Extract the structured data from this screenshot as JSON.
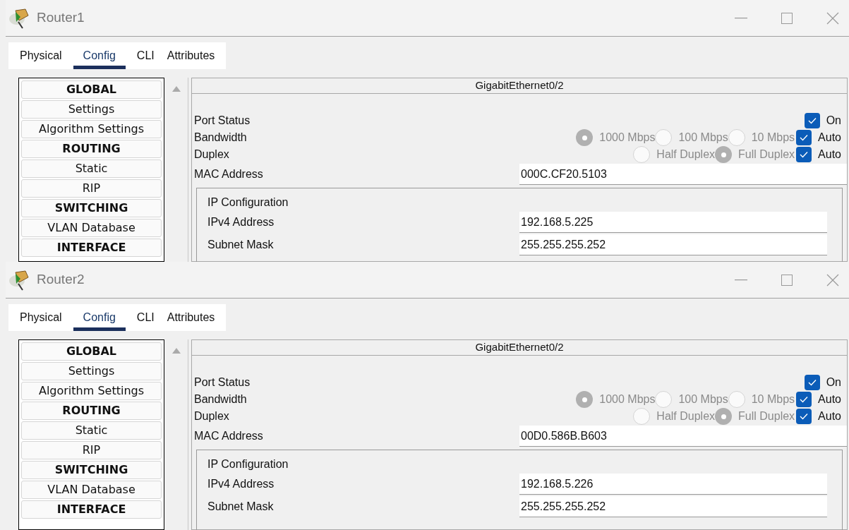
{
  "windows": [
    {
      "title": "Router1",
      "tabs": [
        {
          "label": "Physical",
          "selected": false
        },
        {
          "label": "Config",
          "selected": true
        },
        {
          "label": "CLI",
          "selected": false
        },
        {
          "label": "Attributes",
          "selected": false
        }
      ],
      "sidebar": {
        "items": [
          {
            "label": "GLOBAL",
            "kind": "header"
          },
          {
            "label": "Settings",
            "kind": "item"
          },
          {
            "label": "Algorithm Settings",
            "kind": "item"
          },
          {
            "label": "ROUTING",
            "kind": "header"
          },
          {
            "label": "Static",
            "kind": "item"
          },
          {
            "label": "RIP",
            "kind": "item"
          },
          {
            "label": "SWITCHING",
            "kind": "header"
          },
          {
            "label": "VLAN Database",
            "kind": "item"
          },
          {
            "label": "INTERFACE",
            "kind": "header"
          }
        ]
      },
      "interface": {
        "title": "GigabitEthernet0/2",
        "port_status": {
          "label": "Port Status",
          "option": {
            "label": "On",
            "checked": true
          }
        },
        "bandwidth": {
          "label": "Bandwidth",
          "options": [
            {
              "label": "1000 Mbps",
              "selected": true,
              "disabled": true
            },
            {
              "label": "100 Mbps",
              "selected": false,
              "disabled": true
            },
            {
              "label": "10 Mbps",
              "selected": false,
              "disabled": true
            }
          ],
          "auto": {
            "label": "Auto",
            "checked": true
          }
        },
        "duplex": {
          "label": "Duplex",
          "options": [
            {
              "label": "Half Duplex",
              "selected": false,
              "disabled": true
            },
            {
              "label": "Full Duplex",
              "selected": true,
              "disabled": true
            }
          ],
          "auto": {
            "label": "Auto",
            "checked": true
          }
        },
        "mac_address": {
          "label": "MAC Address",
          "value": "000C.CF20.5103"
        },
        "ip_configuration": {
          "title": "IP Configuration",
          "fields": [
            {
              "label": "IPv4 Address",
              "value": "192.168.5.225"
            },
            {
              "label": "Subnet Mask",
              "value": "255.255.255.252"
            }
          ]
        }
      }
    },
    {
      "title": "Router2",
      "tabs": [
        {
          "label": "Physical",
          "selected": false
        },
        {
          "label": "Config",
          "selected": true
        },
        {
          "label": "CLI",
          "selected": false
        },
        {
          "label": "Attributes",
          "selected": false
        }
      ],
      "sidebar": {
        "items": [
          {
            "label": "GLOBAL",
            "kind": "header"
          },
          {
            "label": "Settings",
            "kind": "item"
          },
          {
            "label": "Algorithm Settings",
            "kind": "item"
          },
          {
            "label": "ROUTING",
            "kind": "header"
          },
          {
            "label": "Static",
            "kind": "item"
          },
          {
            "label": "RIP",
            "kind": "item"
          },
          {
            "label": "SWITCHING",
            "kind": "header"
          },
          {
            "label": "VLAN Database",
            "kind": "item"
          },
          {
            "label": "INTERFACE",
            "kind": "header"
          }
        ]
      },
      "interface": {
        "title": "GigabitEthernet0/2",
        "port_status": {
          "label": "Port Status",
          "option": {
            "label": "On",
            "checked": true
          }
        },
        "bandwidth": {
          "label": "Bandwidth",
          "options": [
            {
              "label": "1000 Mbps",
              "selected": true,
              "disabled": true
            },
            {
              "label": "100 Mbps",
              "selected": false,
              "disabled": true
            },
            {
              "label": "10 Mbps",
              "selected": false,
              "disabled": true
            }
          ],
          "auto": {
            "label": "Auto",
            "checked": true
          }
        },
        "duplex": {
          "label": "Duplex",
          "options": [
            {
              "label": "Half Duplex",
              "selected": false,
              "disabled": true
            },
            {
              "label": "Full Duplex",
              "selected": true,
              "disabled": true
            }
          ],
          "auto": {
            "label": "Auto",
            "checked": true
          }
        },
        "mac_address": {
          "label": "MAC Address",
          "value": "00D0.586B.B603"
        },
        "ip_configuration": {
          "title": "IP Configuration",
          "fields": [
            {
              "label": "IPv4 Address",
              "value": "192.168.5.226"
            },
            {
              "label": "Subnet Mask",
              "value": "255.255.255.252"
            }
          ]
        }
      }
    }
  ]
}
